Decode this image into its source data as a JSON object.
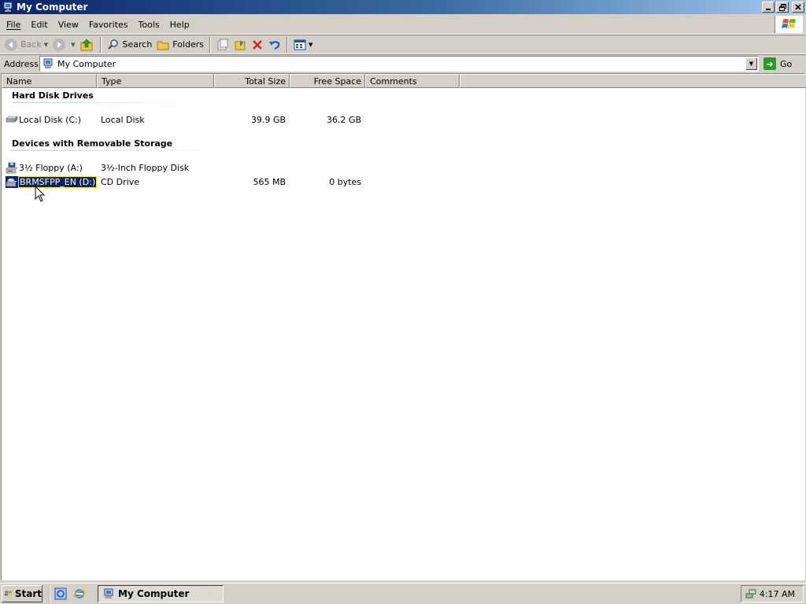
{
  "window": {
    "title": "My Computer",
    "controls": [
      "minimize",
      "restore",
      "close"
    ]
  },
  "menu": [
    {
      "label": "File",
      "key": "F"
    },
    {
      "label": "Edit",
      "key": "E"
    },
    {
      "label": "View",
      "key": "V"
    },
    {
      "label": "Favorites",
      "key": "a"
    },
    {
      "label": "Tools",
      "key": "T"
    },
    {
      "label": "Help",
      "key": "H"
    }
  ],
  "toolbar": {
    "back_label": "Back",
    "search_label": "Search",
    "folders_label": "Folders"
  },
  "address": {
    "label": "Address",
    "value": "My Computer",
    "go_label": "Go"
  },
  "columns": {
    "name": "Name",
    "type": "Type",
    "total": "Total Size",
    "free": "Free Space",
    "comments": "Comments"
  },
  "groups": [
    {
      "title": "Hard Disk Drives",
      "items": [
        {
          "name": "Local Disk (C:)",
          "type": "Local Disk",
          "total": "39.9 GB",
          "free": "36.2 GB",
          "icon": "hard-disk-icon",
          "selected": false
        }
      ]
    },
    {
      "title": "Devices with Removable Storage",
      "items": [
        {
          "name": "3½ Floppy (A:)",
          "type": "3½-Inch Floppy Disk",
          "total": "",
          "free": "",
          "icon": "floppy-drive-icon",
          "selected": false
        },
        {
          "name": "BRMSFPP_EN (D:)",
          "type": "CD Drive",
          "total": "565 MB",
          "free": "0 bytes",
          "icon": "cd-drive-icon",
          "selected": true
        }
      ]
    }
  ],
  "taskbar": {
    "start_label": "Start",
    "tasks": [
      {
        "label": "My Computer",
        "active": true
      }
    ],
    "clock": "4:17 AM"
  },
  "colors": {
    "selection": "#0a246a",
    "titlebar_start": "#0a246a",
    "titlebar_end": "#a6caf0",
    "face": "#d4d0c8"
  }
}
